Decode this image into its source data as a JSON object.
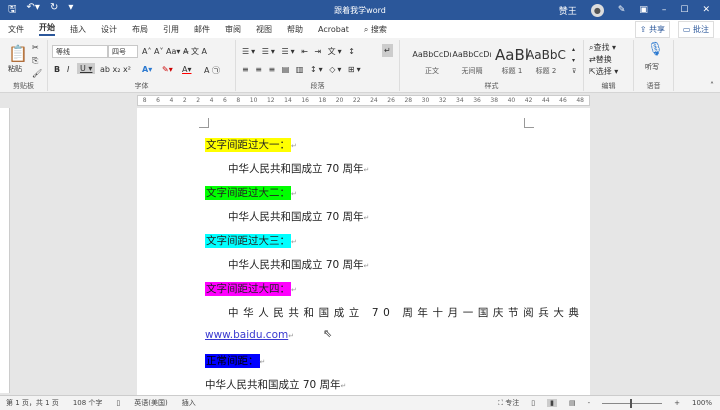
{
  "titlebar": {
    "title": "跟着我学word",
    "user": "赞王",
    "avatar": "person-icon"
  },
  "menu": {
    "tabs": [
      "文件",
      "开始",
      "插入",
      "设计",
      "布局",
      "引用",
      "邮件",
      "审阅",
      "视图",
      "帮助",
      "Acrobat"
    ],
    "search": "搜索",
    "share": "共享",
    "comment": "批注"
  },
  "ribbon": {
    "clipboard": {
      "paste": "粘贴",
      "label": "剪贴板"
    },
    "font": {
      "name": "等线",
      "size": "四号",
      "label": "字体"
    },
    "paragraph": {
      "label": "段落"
    },
    "styles": {
      "label": "样式",
      "items": [
        {
          "preview": "AaBbCcDı",
          "name": "正文"
        },
        {
          "preview": "AaBbCcDı",
          "name": "无间隔"
        },
        {
          "preview": "AaBl",
          "name": "标题 1"
        },
        {
          "preview": "AaBbC",
          "name": "标题 2"
        }
      ]
    },
    "editing": {
      "find": "查找",
      "replace": "替换",
      "select": "选择",
      "label": "编辑"
    },
    "voice": {
      "dictate": "听写",
      "label": "语音"
    }
  },
  "document": {
    "lines": [
      {
        "text": "文字间距过大一：",
        "bg": "#ffff00"
      },
      {
        "text": "中华人民共和国成立 70 周年"
      },
      {
        "text": "文字间距过大二：",
        "bg": "#00ff00"
      },
      {
        "text": "中华人民共和国成立 70 周年"
      },
      {
        "text": "文字间距过大三：",
        "bg": "#00ffff"
      },
      {
        "text": "中华人民共和国成立 70 周年"
      },
      {
        "text": "文字间距过大四：",
        "bg": "#ff00ff"
      },
      {
        "text": "中华人民共和国成立 70 周年十月一国庆节阅兵大典"
      },
      {
        "text": "www.baidu.com"
      },
      {
        "text": "正常间距：",
        "bg": "#0000ff"
      },
      {
        "text": "中华人民共和国成立 70 周年"
      }
    ]
  },
  "status": {
    "page": "第 1 页，共 1 页",
    "words": "108 个字",
    "lang": "英语(美国)",
    "mode": "插入",
    "focus": "专注",
    "zoom": "100%"
  }
}
